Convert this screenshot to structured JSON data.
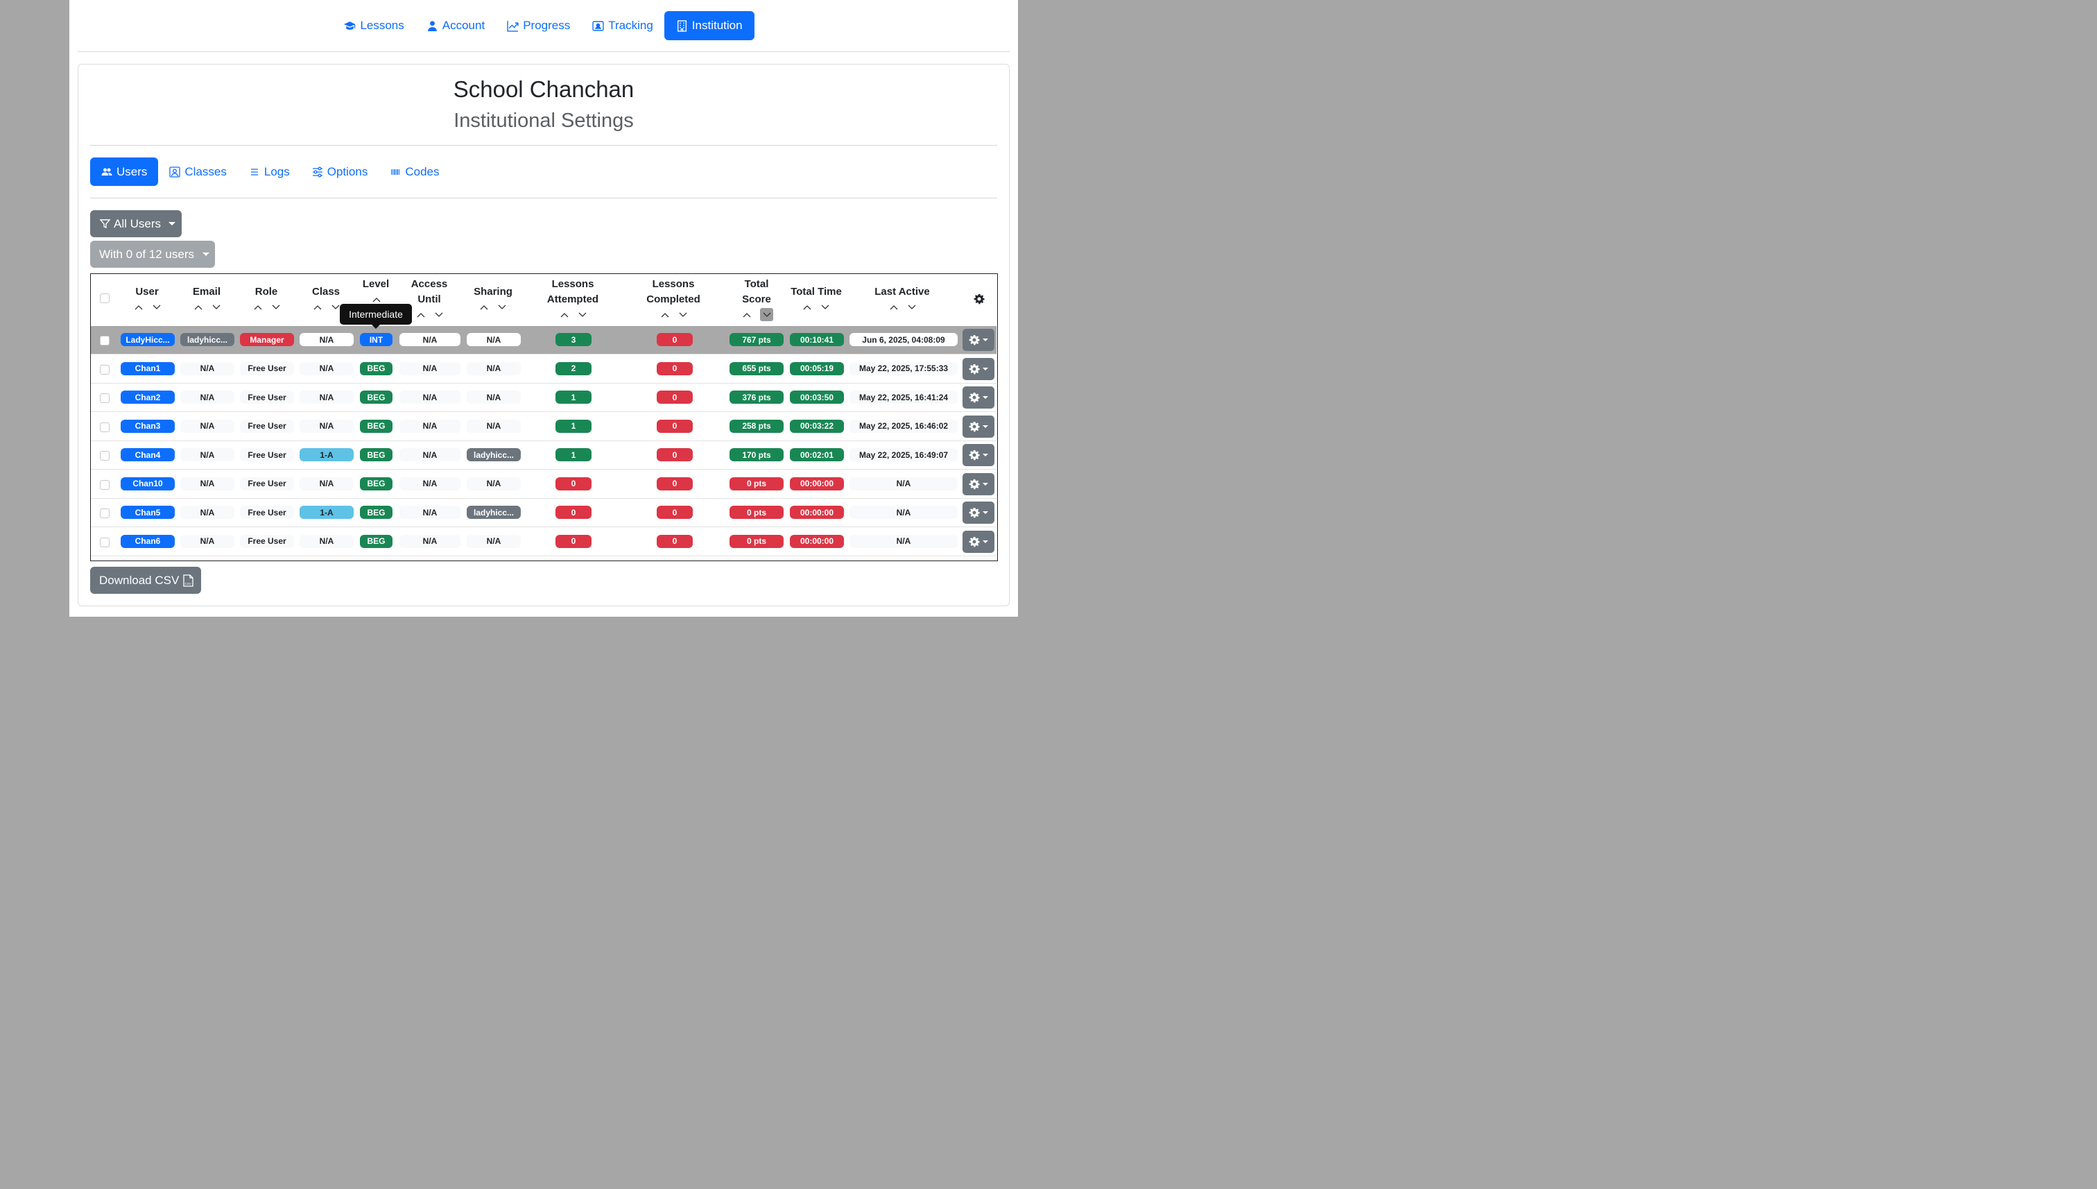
{
  "nav": [
    {
      "label": "Lessons",
      "icon": "graduation-cap-icon"
    },
    {
      "label": "Account",
      "icon": "person-icon"
    },
    {
      "label": "Progress",
      "icon": "graph-up-icon"
    },
    {
      "label": "Tracking",
      "icon": "person-badge-icon"
    },
    {
      "label": "Institution",
      "icon": "building-icon",
      "active": true
    }
  ],
  "header": {
    "school": "School Chanchan",
    "subtitle": "Institutional Settings"
  },
  "tabs": [
    {
      "label": "Users",
      "icon": "people-icon",
      "active": true
    },
    {
      "label": "Classes",
      "icon": "person-square-icon"
    },
    {
      "label": "Logs",
      "icon": "list-icon"
    },
    {
      "label": "Options",
      "icon": "sliders-icon"
    },
    {
      "label": "Codes",
      "icon": "barcode-icon"
    }
  ],
  "filter": {
    "label": "All Users"
  },
  "selection": {
    "label": "With 0 of 12 users"
  },
  "tooltip": "Intermediate",
  "columns": {
    "user": "User",
    "email": "Email",
    "role": "Role",
    "class": "Class",
    "level": "Level",
    "access_1": "Access",
    "access_2": "Until",
    "sharing": "Sharing",
    "attempted_1": "Lessons",
    "attempted_2": "Attempted",
    "completed_1": "Lessons",
    "completed_2": "Completed",
    "score_1": "Total",
    "score_2": "Score",
    "time": "Total Time",
    "active": "Last Active"
  },
  "rows": [
    {
      "user": "LadyHicc...",
      "email": "ladyhicc...",
      "role": "Manager",
      "class": "N/A",
      "level": "INT",
      "access": "N/A",
      "sharing": "N/A",
      "attempted": "3",
      "completed": "0",
      "score": "767 pts",
      "time": "00:10:41",
      "last": "Jun 6, 2025, 04:08:09"
    },
    {
      "user": "Chan1",
      "email": "N/A",
      "role": "Free User",
      "class": "N/A",
      "level": "BEG",
      "access": "N/A",
      "sharing": "N/A",
      "attempted": "2",
      "completed": "0",
      "score": "655 pts",
      "time": "00:05:19",
      "last": "May 22, 2025, 17:55:33"
    },
    {
      "user": "Chan2",
      "email": "N/A",
      "role": "Free User",
      "class": "N/A",
      "level": "BEG",
      "access": "N/A",
      "sharing": "N/A",
      "attempted": "1",
      "completed": "0",
      "score": "376 pts",
      "time": "00:03:50",
      "last": "May 22, 2025, 16:41:24"
    },
    {
      "user": "Chan3",
      "email": "N/A",
      "role": "Free User",
      "class": "N/A",
      "level": "BEG",
      "access": "N/A",
      "sharing": "N/A",
      "attempted": "1",
      "completed": "0",
      "score": "258 pts",
      "time": "00:03:22",
      "last": "May 22, 2025, 16:46:02"
    },
    {
      "user": "Chan4",
      "email": "N/A",
      "role": "Free User",
      "class": "1-A",
      "level": "BEG",
      "access": "N/A",
      "sharing": "ladyhicc...",
      "attempted": "1",
      "completed": "0",
      "score": "170 pts",
      "time": "00:02:01",
      "last": "May 22, 2025, 16:49:07"
    },
    {
      "user": "Chan10",
      "email": "N/A",
      "role": "Free User",
      "class": "N/A",
      "level": "BEG",
      "access": "N/A",
      "sharing": "N/A",
      "attempted": "0",
      "completed": "0",
      "score": "0 pts",
      "time": "00:00:00",
      "last": "N/A"
    },
    {
      "user": "Chan5",
      "email": "N/A",
      "role": "Free User",
      "class": "1-A",
      "level": "BEG",
      "access": "N/A",
      "sharing": "ladyhicc...",
      "attempted": "0",
      "completed": "0",
      "score": "0 pts",
      "time": "00:00:00",
      "last": "N/A"
    },
    {
      "user": "Chan6",
      "email": "N/A",
      "role": "Free User",
      "class": "N/A",
      "level": "BEG",
      "access": "N/A",
      "sharing": "N/A",
      "attempted": "0",
      "completed": "0",
      "score": "0 pts",
      "time": "00:00:00",
      "last": "N/A"
    }
  ],
  "download": {
    "label": "Download CSV",
    "icon": "filetype-csv-icon"
  },
  "colors": {
    "primary": "#0d6efd",
    "secondary": "#6c757d",
    "success": "#198754",
    "danger": "#dc3545",
    "info": "#5ec2e6"
  }
}
